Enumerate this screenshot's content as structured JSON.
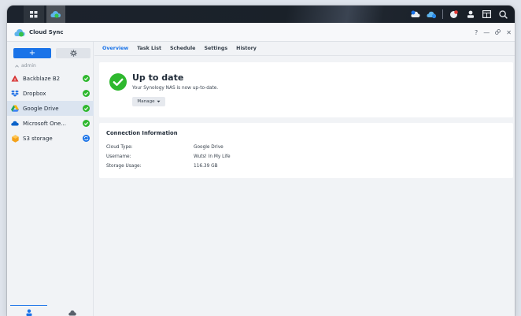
{
  "app": {
    "title": "Cloud Sync"
  },
  "window_controls": {
    "help": "?",
    "minimize": "—",
    "pin": "⚲",
    "close": "✕"
  },
  "sidebar": {
    "add_label": "+",
    "group_label": "admin",
    "items": [
      {
        "label": "Backblaze B2",
        "status": "ok",
        "icon": "backblaze-icon",
        "active": false
      },
      {
        "label": "Dropbox",
        "status": "ok",
        "icon": "dropbox-icon",
        "active": false
      },
      {
        "label": "Google Drive",
        "status": "ok",
        "icon": "google-drive-icon",
        "active": true
      },
      {
        "label": "Microsoft One...",
        "status": "ok",
        "icon": "onedrive-icon",
        "active": false
      },
      {
        "label": "S3 storage",
        "status": "syncing",
        "icon": "s3-icon",
        "active": false
      }
    ]
  },
  "tabs": [
    {
      "label": "Overview",
      "active": true
    },
    {
      "label": "Task List",
      "active": false
    },
    {
      "label": "Schedule",
      "active": false
    },
    {
      "label": "Settings",
      "active": false
    },
    {
      "label": "History",
      "active": false
    }
  ],
  "status": {
    "title": "Up to date",
    "description": "Your Synology NAS is now up-to-date.",
    "manage_label": "Manage"
  },
  "connection": {
    "title": "Connection Information",
    "rows": [
      {
        "key": "Cloud Type:",
        "value": "Google Drive"
      },
      {
        "key": "Username:",
        "value": "Wuts! In My Life"
      },
      {
        "key": "Storage Usage:",
        "value": "116.39 GB"
      }
    ]
  },
  "colors": {
    "accent": "#1a73e8",
    "ok": "#2eb82e",
    "syncing": "#1a73e8"
  }
}
